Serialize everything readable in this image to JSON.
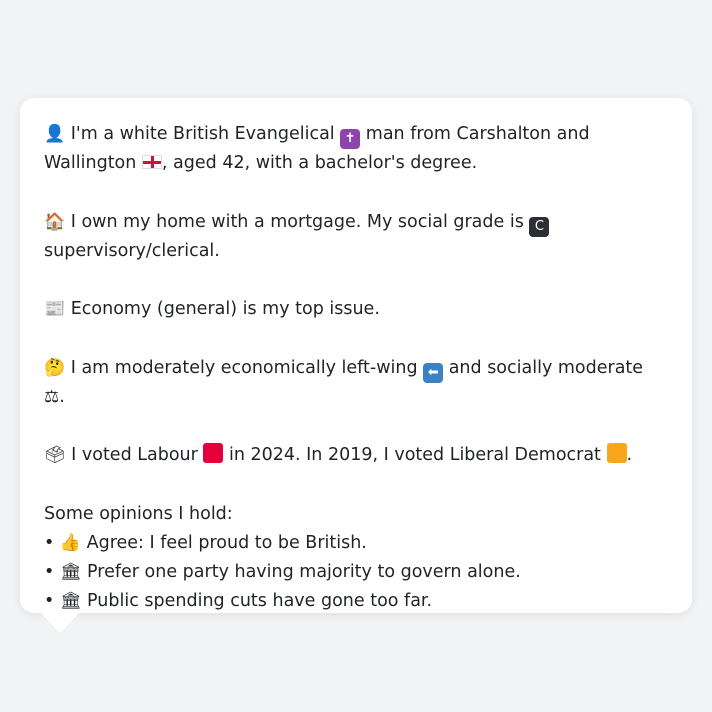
{
  "colors": {
    "background": "#f2f3f5",
    "bubble": "#ffffff",
    "text": "#1f2328",
    "labour": "#e4003b",
    "libdem": "#faa61a",
    "cross_badge": "#8e44ad",
    "grade_badge": "#2d2f36",
    "arrow_badge": "#3b82c4"
  },
  "profile": {
    "line1": {
      "icon": "person-silhouette-icon",
      "glyph": "👤",
      "text_a": " I'm a white British Evangelical ",
      "cross_glyph": "✝",
      "text_b": " man from Carshalton and Wallington ",
      "flag_icon": "england-flag-icon",
      "text_c": ", aged 42, with a bachelor's degree."
    },
    "line2": {
      "icon": "house-icon",
      "glyph": "🏠",
      "text_a": " I own my home with a mortgage. My social grade is ",
      "grade_glyph": "C",
      "text_b": " supervisory/clerical."
    },
    "line3": {
      "icon": "newspaper-icon",
      "glyph": "📰",
      "text": " Economy (general) is my top issue."
    },
    "line4": {
      "icon": "thinking-face-icon",
      "glyph": "🤔",
      "text_a": " I am moderately economically left-wing ",
      "arrow_glyph": "⬅",
      "text_b": " and socially moderate ",
      "scale_glyph": "⚖",
      "text_c": "."
    },
    "line5": {
      "icon": "ballot-box-icon",
      "glyph": "🗳",
      "text_a": " I voted Labour ",
      "text_b": " in 2024. In 2019, I voted Liberal Democrat ",
      "text_c": "."
    },
    "opinions_heading": "Some opinions I hold:",
    "opinions": [
      {
        "icon": "thumbs-up-icon",
        "glyph": "👍",
        "text": " Agree: I feel proud to be British."
      },
      {
        "icon": "classical-building-icon",
        "glyph": "🏛",
        "text": " Prefer one party having majority to govern alone."
      },
      {
        "icon": "classical-building-icon",
        "glyph": "🏛",
        "text": " Public spending cuts have gone too far."
      }
    ]
  }
}
